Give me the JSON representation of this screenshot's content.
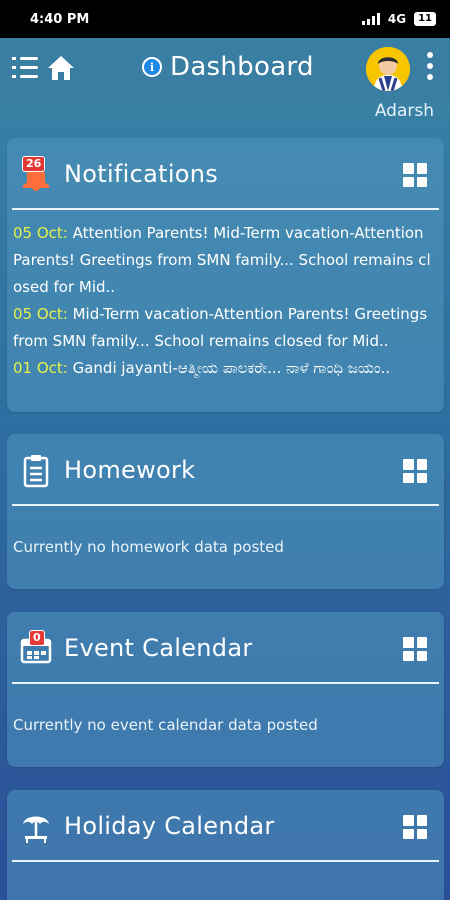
{
  "status": {
    "time": "4:40 PM",
    "network": "4G",
    "battery": "11"
  },
  "appbar": {
    "title": "Dashboard",
    "username": "Adarsh"
  },
  "notifications": {
    "title": "Notifications",
    "badge": "26",
    "items": [
      {
        "date": "05 Oct:",
        "text": " Attention Parents! Mid-Term vacation-Attention Parents! Greetings from SMN family... School remains closed for Mid.."
      },
      {
        "date": "05 Oct:",
        "text": " Mid-Term vacation-Attention Parents! Greetings from SMN family... School remains closed for Mid.."
      },
      {
        "date": "01 Oct:",
        "text": " Gandi jayanti-ಆತ್ಮೀಯ ಪಾಲಕರೇ... ನಾಳೆ ಗಾಂಧಿ ಜಯಂ.."
      }
    ]
  },
  "homework": {
    "title": "Homework",
    "empty": "Currently no homework data posted"
  },
  "events": {
    "title": "Event Calendar",
    "badge": "0",
    "empty": "Currently no event calendar data posted"
  },
  "holiday": {
    "title": "Holiday Calendar"
  },
  "icons": {
    "menu": "menu-icon",
    "home": "home-icon",
    "info": "info-icon",
    "more": "kebab-icon",
    "bell": "bell-icon",
    "clipboard": "clipboard-icon",
    "calendar": "calendar-icon",
    "beach": "beach-umbrella-icon",
    "grid": "grid-icon"
  },
  "colors": {
    "appbar": "#3a7fa3",
    "date_highlight": "#e5f04a",
    "badge": "#e53935"
  }
}
